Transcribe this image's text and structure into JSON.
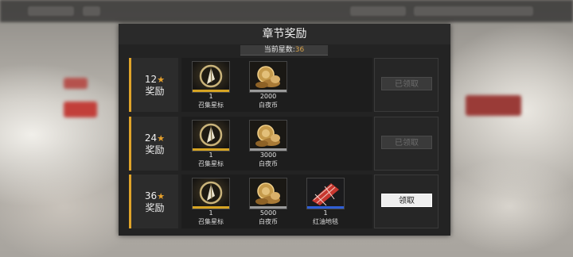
{
  "panel": {
    "title": "章节奖励",
    "stars_label": "当前星数:",
    "stars_value": "36"
  },
  "rows": [
    {
      "stars": "12",
      "reward_word": "奖励",
      "items": [
        {
          "qty": "1",
          "name": "召集星标",
          "icon": "beacon-icon",
          "rarity": "gold"
        },
        {
          "qty": "2000",
          "name": "白夜币",
          "icon": "coin-icon",
          "rarity": "gray"
        }
      ],
      "button": "已领取",
      "button_state": "claimed"
    },
    {
      "stars": "24",
      "reward_word": "奖励",
      "items": [
        {
          "qty": "1",
          "name": "召集星标",
          "icon": "beacon-icon",
          "rarity": "gold"
        },
        {
          "qty": "3000",
          "name": "白夜币",
          "icon": "coin-icon",
          "rarity": "gray"
        }
      ],
      "button": "已领取",
      "button_state": "claimed"
    },
    {
      "stars": "36",
      "reward_word": "奖励",
      "items": [
        {
          "qty": "1",
          "name": "召集星标",
          "icon": "beacon-icon",
          "rarity": "gold"
        },
        {
          "qty": "5000",
          "name": "白夜币",
          "icon": "coin-icon",
          "rarity": "gray"
        },
        {
          "qty": "1",
          "name": "红油地毯",
          "icon": "red-carpet-icon",
          "rarity": "blue"
        }
      ],
      "button": "领取",
      "button_state": "available"
    }
  ],
  "colors": {
    "accent": "#e0a42a",
    "star": "#e6a02c",
    "rarity_gold": "#d6a423",
    "rarity_gray": "#9a9a9a",
    "rarity_blue": "#2f5fd6"
  }
}
